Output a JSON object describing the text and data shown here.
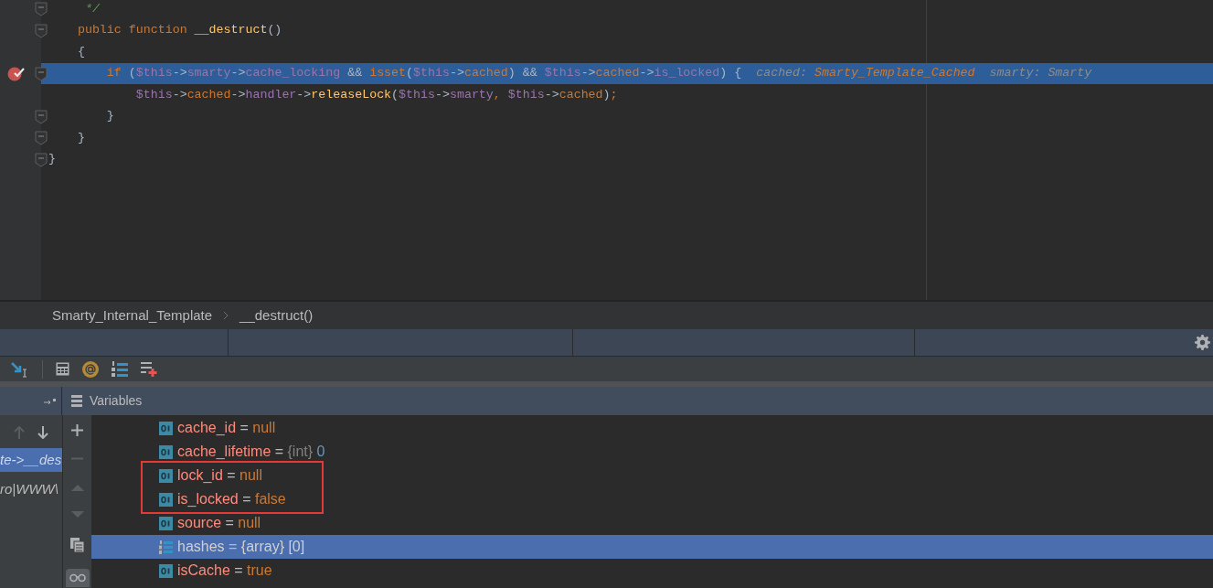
{
  "editor": {
    "lines": [
      {
        "fold_marker": true,
        "breakpoint": false,
        "current": false,
        "tokens": [
          {
            "kind": "comment",
            "text": "     */"
          }
        ]
      },
      {
        "fold_marker": true,
        "breakpoint": false,
        "current": false,
        "tokens": [
          {
            "kind": "keyword",
            "text": "    public function "
          },
          {
            "kind": "func",
            "text": "__destruct"
          },
          {
            "kind": "plain",
            "text": "()"
          }
        ]
      },
      {
        "fold_marker": false,
        "breakpoint": false,
        "current": false,
        "tokens": [
          {
            "kind": "plain",
            "text": "    {"
          }
        ]
      },
      {
        "fold_marker": true,
        "breakpoint": true,
        "current": true,
        "tokens": [
          {
            "kind": "keyword",
            "text": "        if"
          },
          {
            "kind": "plain",
            "text": " ("
          },
          {
            "kind": "var",
            "text": "$this"
          },
          {
            "kind": "plain",
            "text": "->"
          },
          {
            "kind": "field",
            "text": "smarty"
          },
          {
            "kind": "plain",
            "text": "->"
          },
          {
            "kind": "field",
            "text": "cache_locking"
          },
          {
            "kind": "plain",
            "text": " && "
          },
          {
            "kind": "keyword",
            "text": "isset"
          },
          {
            "kind": "plain",
            "text": "("
          },
          {
            "kind": "var",
            "text": "$this"
          },
          {
            "kind": "plain",
            "text": "->"
          },
          {
            "kind": "field_alt",
            "text": "cached"
          },
          {
            "kind": "plain",
            "text": ") && "
          },
          {
            "kind": "var",
            "text": "$this"
          },
          {
            "kind": "plain",
            "text": "->"
          },
          {
            "kind": "field_alt",
            "text": "cached"
          },
          {
            "kind": "plain",
            "text": "->"
          },
          {
            "kind": "field",
            "text": "is_locked"
          },
          {
            "kind": "plain",
            "text": ") {  "
          },
          {
            "kind": "hint",
            "text": "cached: "
          },
          {
            "kind": "hint_class",
            "text": "Smarty_Template_Cached"
          },
          {
            "kind": "hint",
            "text": "  smarty: Smarty"
          }
        ]
      },
      {
        "fold_marker": false,
        "breakpoint": false,
        "current": false,
        "tokens": [
          {
            "kind": "var",
            "text": "            $this"
          },
          {
            "kind": "plain",
            "text": "->"
          },
          {
            "kind": "field_alt",
            "text": "cached"
          },
          {
            "kind": "plain",
            "text": "->"
          },
          {
            "kind": "field",
            "text": "handler"
          },
          {
            "kind": "plain",
            "text": "->"
          },
          {
            "kind": "func",
            "text": "releaseLock"
          },
          {
            "kind": "plain",
            "text": "("
          },
          {
            "kind": "var",
            "text": "$this"
          },
          {
            "kind": "plain",
            "text": "->"
          },
          {
            "kind": "field",
            "text": "smarty"
          },
          {
            "kind": "keyword",
            "text": ", "
          },
          {
            "kind": "var",
            "text": "$this"
          },
          {
            "kind": "plain",
            "text": "->"
          },
          {
            "kind": "field_alt",
            "text": "cached"
          },
          {
            "kind": "plain",
            "text": ")"
          },
          {
            "kind": "keyword",
            "text": ";"
          }
        ]
      },
      {
        "fold_marker": true,
        "breakpoint": false,
        "current": false,
        "tokens": [
          {
            "kind": "plain",
            "text": "        }"
          }
        ]
      },
      {
        "fold_marker": true,
        "breakpoint": false,
        "current": false,
        "tokens": [
          {
            "kind": "plain",
            "text": "    }"
          }
        ]
      },
      {
        "fold_marker": true,
        "breakpoint": false,
        "current": false,
        "tokens": [
          {
            "kind": "plain",
            "text": "}"
          }
        ]
      }
    ]
  },
  "breadcrumb": [
    "Smarty_Internal_Template",
    "__destruct()"
  ],
  "variables_header": "Variables",
  "frames": [
    {
      "text": "te->__des",
      "selected": true
    },
    {
      "text": "ro|WWW\\",
      "selected": false
    }
  ],
  "variables": [
    {
      "kind": "field",
      "name": "cache_id",
      "equals": "=",
      "value": {
        "kind": "keyword",
        "text": "null"
      },
      "selected": false,
      "circled": false
    },
    {
      "kind": "field",
      "name": "cache_lifetime",
      "equals": "=",
      "type": "{int}",
      "value": {
        "kind": "number",
        "text": "0"
      },
      "selected": false,
      "circled": false
    },
    {
      "kind": "field",
      "name": "lock_id",
      "equals": "=",
      "value": {
        "kind": "keyword",
        "text": "null"
      },
      "selected": false,
      "circled": true
    },
    {
      "kind": "field",
      "name": "is_locked",
      "equals": "=",
      "value": {
        "kind": "keyword",
        "text": "false"
      },
      "selected": false,
      "circled": true
    },
    {
      "kind": "field",
      "name": "source",
      "equals": "=",
      "value": {
        "kind": "keyword",
        "text": "null"
      },
      "selected": false,
      "circled": false
    },
    {
      "kind": "array",
      "name": "hashes",
      "equals": "=",
      "type": "{array}",
      "value": {
        "kind": "plain",
        "text": "[0]"
      },
      "selected": true,
      "circled": false
    },
    {
      "kind": "field",
      "name": "isCache",
      "equals": "=",
      "value": {
        "kind": "keyword",
        "text": "true"
      },
      "selected": false,
      "circled": false
    }
  ]
}
